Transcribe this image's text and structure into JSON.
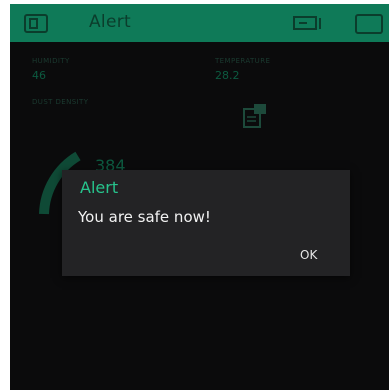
{
  "app": {
    "title": "Alert"
  },
  "widgets": {
    "humidity": {
      "label": "HUMIDITY",
      "value": "46"
    },
    "temperature": {
      "label": "TEMPERATURE",
      "value": "28.2"
    },
    "dust": {
      "label": "DUST DENSITY",
      "value": "384"
    }
  },
  "dialog": {
    "title": "Alert",
    "message": "You are safe now!",
    "ok_label": "OK"
  },
  "icons": {
    "top_left": "project-frame-icon",
    "top_right_1": "battery-icon",
    "top_right_2": "tablet-icon",
    "widget": "terminal-icon"
  },
  "colors": {
    "accent": "#27c48d",
    "topbar": "#0f7a58",
    "background": "#0b0b0c",
    "dialog": "#232325"
  }
}
